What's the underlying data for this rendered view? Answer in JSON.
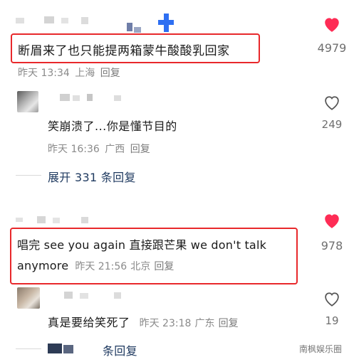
{
  "comments": [
    {
      "text": "断眉来了也只能提两箱蒙牛酸酸乳回家",
      "time": "昨天 13:34",
      "location": "上海",
      "reply_label": "回复",
      "likes": "4979",
      "liked": true
    },
    {
      "text": "笑崩溃了...你是懂节目的",
      "time": "昨天 16:36",
      "location": "广西",
      "reply_label": "回复",
      "likes": "249",
      "liked": false
    },
    {
      "text_line1": "唱完 see you again 直接跟芒果 we don't talk",
      "text_line2_start": "anymore",
      "time": "昨天 21:56",
      "location": "北京",
      "reply_label": "回复",
      "likes": "978",
      "liked": true
    },
    {
      "text": "真是要给笑死了",
      "time": "昨天 23:18",
      "location": "广东",
      "reply_label": "回复",
      "likes": "19",
      "liked": false
    }
  ],
  "expand_replies": "展开 331 条回复",
  "expand_replies_bottom": "条回复",
  "watermark": "南枫娱乐圈",
  "colors": {
    "like_red": "#fe2c55",
    "highlight_box": "#e8282b",
    "expand_blue": "#1f3a60"
  }
}
